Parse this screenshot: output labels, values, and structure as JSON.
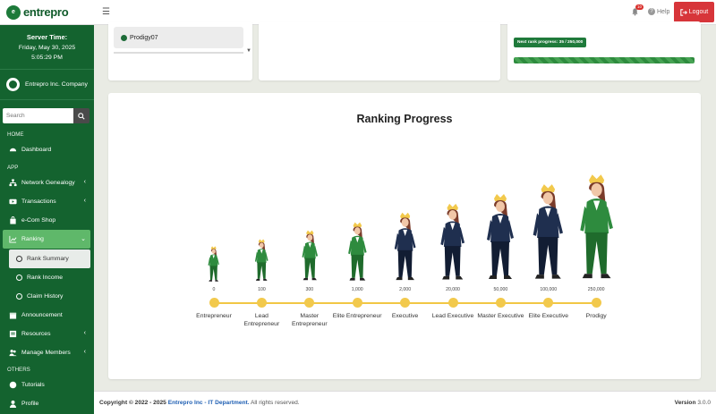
{
  "brand": {
    "name": "entrepro",
    "logo_text": "e"
  },
  "server": {
    "label": "Server Time:",
    "date": "Friday, May 30, 2025",
    "time": "5:05:29 PM"
  },
  "company": {
    "name": "Entrepro Inc. Company"
  },
  "search": {
    "placeholder": "Search"
  },
  "sidebar": {
    "home_header": "HOME",
    "dashboard": "Dashboard",
    "app_header": "APP",
    "network_genealogy": "Network Genealogy",
    "transactions": "Transactions",
    "ecom_shop": "e-Com Shop",
    "ranking": "Ranking",
    "rank_summary": "Rank Summary",
    "rank_income": "Rank Income",
    "claim_history": "Claim History",
    "announcement": "Announcement",
    "resources": "Resources",
    "manage_members": "Manage Members",
    "others_header": "OTHERS",
    "tutorials": "Tutorials",
    "profile": "Profile"
  },
  "topbar": {
    "notif_count": "10",
    "help": "Help",
    "logout": "Logout"
  },
  "user": {
    "username": "Prodigy07"
  },
  "next_rank": {
    "label": "Next rank progress: 35 / 250,000",
    "fraction": 1.0
  },
  "ranking": {
    "title": "Ranking Progress",
    "ranks": [
      {
        "name": "Entrepreneur",
        "points": "0",
        "scale": 0.34
      },
      {
        "name": "Lead Entrepreneur",
        "points": "100",
        "scale": 0.4
      },
      {
        "name": "Master Entrepreneur",
        "points": "300",
        "scale": 0.48
      },
      {
        "name": "Elite Entrepreneur",
        "points": "1,000",
        "scale": 0.56
      },
      {
        "name": "Executive",
        "points": "2,000",
        "scale": 0.65
      },
      {
        "name": "Lead Executive",
        "points": "20,000",
        "scale": 0.73
      },
      {
        "name": "Master Executive",
        "points": "50,000",
        "scale": 0.82
      },
      {
        "name": "Elite Executive",
        "points": "100,000",
        "scale": 0.91
      },
      {
        "name": "Prodigy",
        "points": "250,000",
        "scale": 1.0
      }
    ]
  },
  "footer": {
    "copyright_prefix": "Copyright © 2022 - 2025",
    "dept": "Entrepro Inc - IT Department.",
    "rights": "All rights reserved.",
    "version_label": "Version",
    "version": "3.0.0"
  },
  "colors": {
    "sidebar": "#14632f",
    "accent": "#f2c94c",
    "logout": "#d7353a",
    "suit_green": "#2e8b3e",
    "suit_navy": "#1f2f4f"
  }
}
